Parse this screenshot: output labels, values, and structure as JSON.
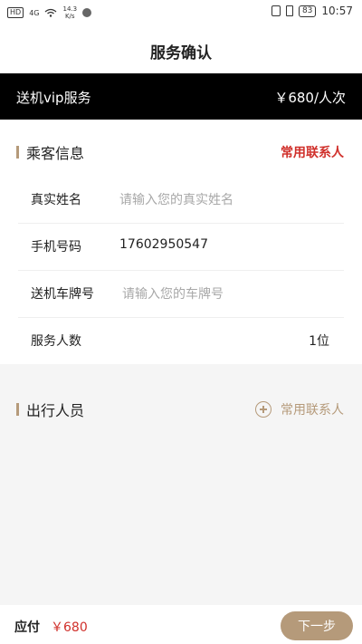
{
  "status_bar": {
    "hd1": "HD",
    "signal": "4G",
    "net_speed_value": "14.3",
    "net_speed_unit": "K/s",
    "battery": "83",
    "time": "10:57"
  },
  "header": {
    "title": "服务确认"
  },
  "service": {
    "name": "送机vip服务",
    "price": "￥680/人次"
  },
  "passenger_section": {
    "title": "乘客信息",
    "contact_link": "常用联系人",
    "fields": [
      {
        "label": "真实姓名",
        "placeholder": "请输入您的真实姓名"
      },
      {
        "label": "手机号码",
        "value": "17602950547"
      },
      {
        "label": "送机车牌号",
        "placeholder": "请输入您的车牌号"
      },
      {
        "label": "服务人数",
        "value": "1位"
      }
    ]
  },
  "travel_section": {
    "title": "出行人员",
    "add_contact": "常用联系人"
  },
  "footer": {
    "pay_label": "应付",
    "amount": "￥680",
    "next_label": "下一步"
  },
  "colors": {
    "accent": "#b59a7a",
    "red": "#d0302b",
    "black_bar": "#000000"
  }
}
